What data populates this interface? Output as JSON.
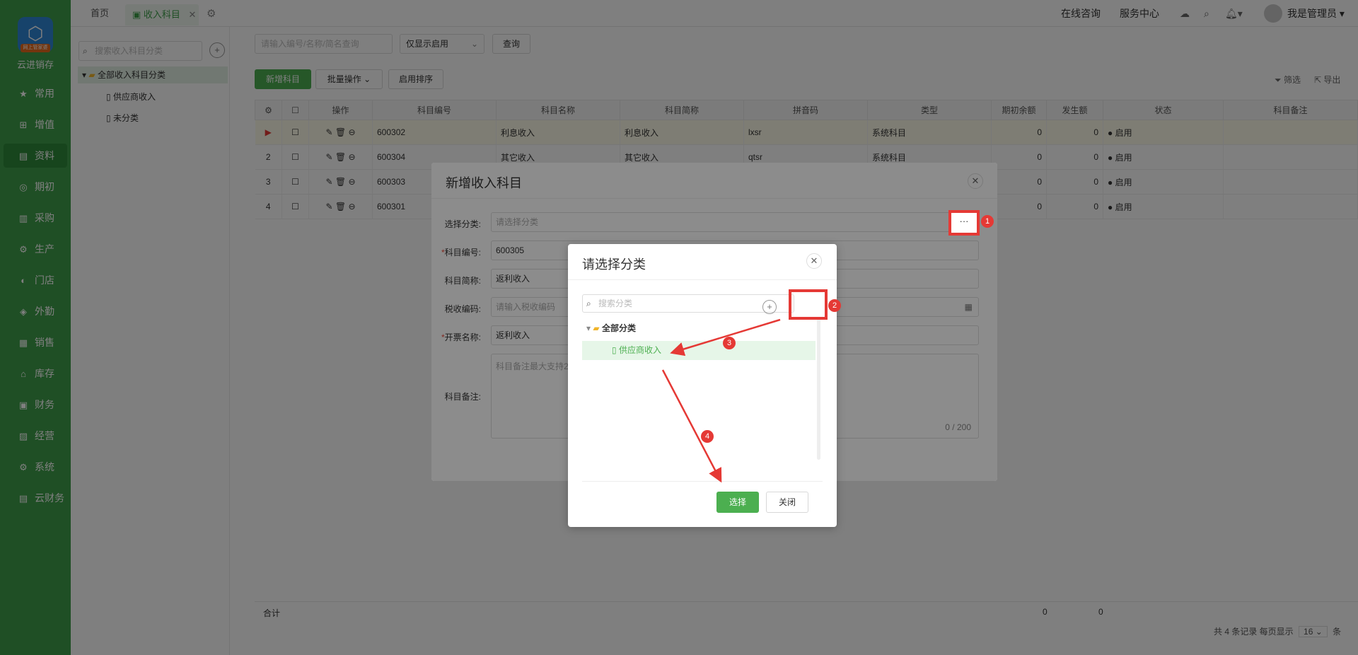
{
  "sidebar": {
    "logo_badge": "网上管家婆",
    "brand": "云进销存",
    "items": [
      {
        "label": "常用",
        "icon": "★"
      },
      {
        "label": "增值",
        "icon": "⊞"
      },
      {
        "label": "资料",
        "icon": "▤"
      },
      {
        "label": "期初",
        "icon": "◎"
      },
      {
        "label": "采购",
        "icon": "▥"
      },
      {
        "label": "生产",
        "icon": "⚙"
      },
      {
        "label": "门店",
        "icon": "◐"
      },
      {
        "label": "外勤",
        "icon": "◈"
      },
      {
        "label": "销售",
        "icon": "▦"
      },
      {
        "label": "库存",
        "icon": "⌂"
      },
      {
        "label": "财务",
        "icon": "▣"
      },
      {
        "label": "经营",
        "icon": "▨"
      },
      {
        "label": "系统",
        "icon": "⚙"
      },
      {
        "label": "云财务",
        "icon": "▤"
      }
    ]
  },
  "topbar": {
    "tab_home": "首页",
    "tab_active": "收入科目",
    "online_consult": "在线咨询",
    "service_center": "服务中心",
    "user_name": "我是管理员"
  },
  "tree": {
    "search_placeholder": "搜索收入科目分类",
    "root": "全部收入科目分类",
    "children": [
      "供应商收入",
      "未分类"
    ]
  },
  "toolbar": {
    "search_placeholder": "请输入编号/名称/简名查询",
    "filter_select": "仅显示启用",
    "query": "查询",
    "new": "新增科目",
    "batch": "批量操作",
    "sort": "启用排序",
    "filter": "筛选",
    "export": "导出"
  },
  "table": {
    "headers": [
      "操作",
      "科目编号",
      "科目名称",
      "科目简称",
      "拼音码",
      "类型",
      "期初余额",
      "发生额",
      "状态",
      "科目备注"
    ],
    "rows": [
      {
        "idx": "▶",
        "code": "600302",
        "name": "利息收入",
        "short": "利息收入",
        "py": "lxsr",
        "type": "系统科目",
        "begin": "0",
        "amount": "0",
        "status": "● 启用"
      },
      {
        "idx": "2",
        "code": "600304",
        "name": "其它收入",
        "short": "其它收入",
        "py": "qtsr",
        "type": "系统科目",
        "begin": "0",
        "amount": "0",
        "status": "● 启用"
      },
      {
        "idx": "3",
        "code": "600303",
        "name": "",
        "short": "",
        "py": "",
        "type": "",
        "begin": "0",
        "amount": "0",
        "status": "● 启用"
      },
      {
        "idx": "4",
        "code": "600301",
        "name": "",
        "short": "",
        "py": "",
        "type": "",
        "begin": "0",
        "amount": "0",
        "status": "● 启用"
      }
    ],
    "footer_label": "合计",
    "footer_begin": "0",
    "footer_amount": "0",
    "pager_text": "共 4 条记录  每页显示",
    "page_size": "16",
    "pager_unit": "条"
  },
  "dialog_new": {
    "title": "新增收入科目",
    "label_category": "选择分类:",
    "category_placeholder": "请选择分类",
    "label_code": "科目编号:",
    "code_value": "600305",
    "label_short": "科目简称:",
    "short_value": "返利收入",
    "label_tax": "税收编码:",
    "tax_placeholder": "请输入税收编码",
    "label_invoice": "开票名称:",
    "invoice_value": "返利收入",
    "label_remark": "科目备注:",
    "remark_placeholder": "科目备注最大支持2",
    "remark_count": "0 / 200",
    "more_btn": "···"
  },
  "dialog_select": {
    "title": "请选择分类",
    "search_placeholder": "搜索分类",
    "root": "全部分类",
    "child": "供应商收入",
    "select_btn": "选择",
    "close_btn": "关闭"
  },
  "annotations": [
    "1",
    "2",
    "3",
    "4"
  ],
  "colors": {
    "brand_green": "#3f9e4a",
    "annotation_red": "#e53935"
  }
}
